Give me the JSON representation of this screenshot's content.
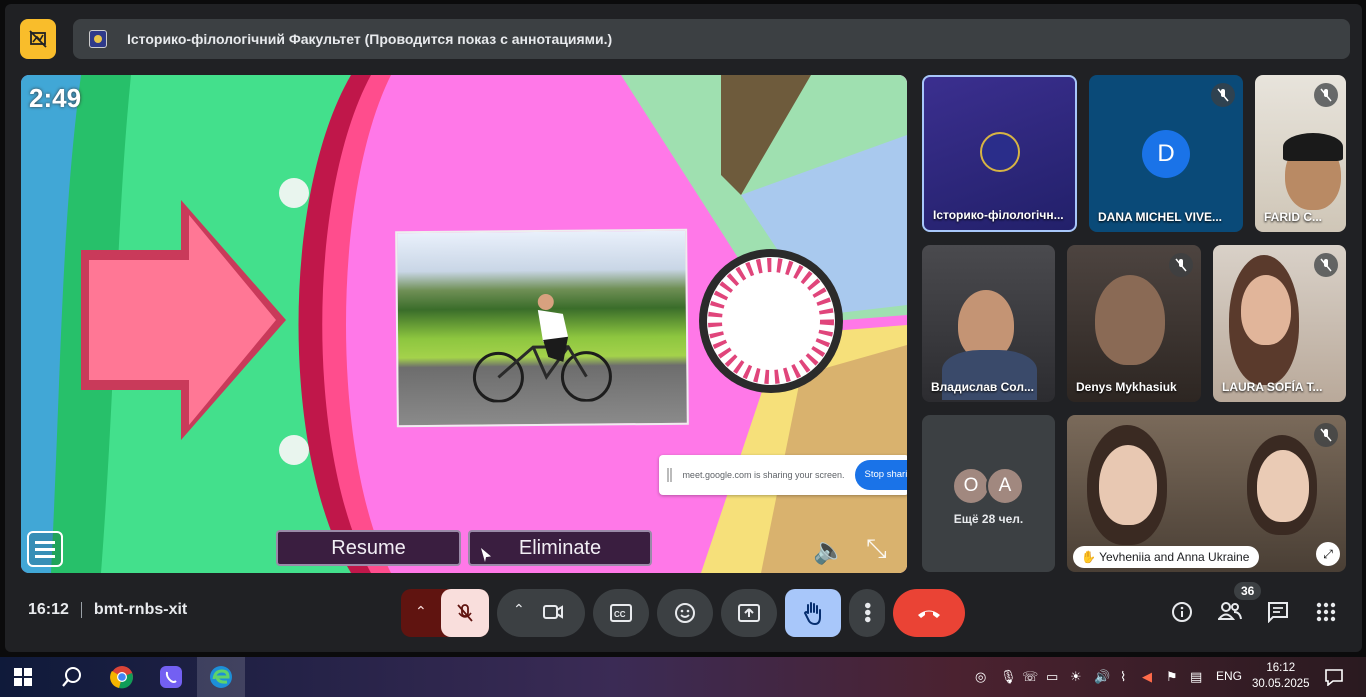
{
  "header": {
    "meeting_title": "Історико-філологічний Факультет (Проводится показ с аннотациями.)"
  },
  "presentation": {
    "timer": "2:49",
    "resume_label": "Resume",
    "eliminate_label": "Eliminate",
    "share_notice": "meet.google.com is sharing your screen.",
    "stop_sharing_label": "Stop shari"
  },
  "participants": {
    "tiles": [
      {
        "name": "Історико-філологічн...",
        "muted": false
      },
      {
        "name": "DANA MICHEL VIVE...",
        "initial": "D",
        "muted": true
      },
      {
        "name": "FARID C...",
        "muted": true
      },
      {
        "name": "Владислав Сол...",
        "muted": false
      },
      {
        "name": "Denys Mykhasiuk",
        "muted": true
      },
      {
        "name": "LAURA SOFÍA T...",
        "muted": true
      },
      {
        "name": "Yevheniia and Anna Ukraine",
        "muted": true
      }
    ],
    "more": {
      "avatar_1": "O",
      "avatar_2": "A",
      "label": "Ещё 28 чел."
    }
  },
  "controls": {
    "time": "16:12",
    "meeting_code": "bmt-rnbs-xit",
    "participant_count": "36"
  },
  "taskbar": {
    "language": "ENG",
    "time": "16:12",
    "date": "30.05.2025"
  },
  "colors": {
    "meet_bg": "#202124",
    "annotation_accent": "#f9bd2b",
    "hangup": "#ea4335",
    "hand_raised": "#a8c7fa",
    "speaker_avatar": "#1a73e8"
  }
}
